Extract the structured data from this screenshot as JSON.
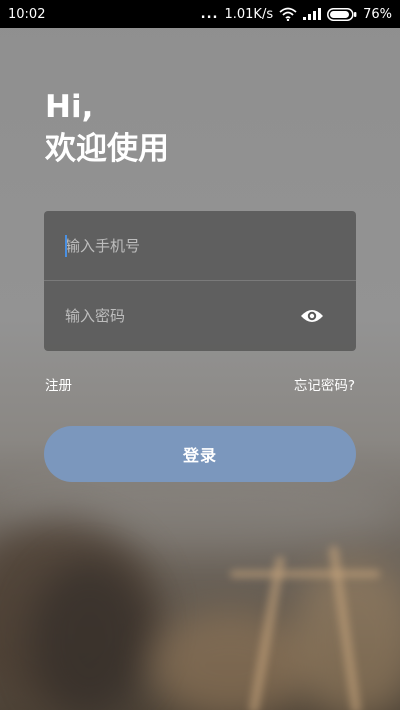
{
  "status_bar": {
    "time": "10:02",
    "signal_dots": "...",
    "network_speed": "1.01K/s",
    "battery_percent": "76%",
    "icons": [
      "wifi-icon",
      "signal-icon",
      "battery-icon"
    ]
  },
  "greeting": {
    "line1": "Hi,",
    "line2": "欢迎使用"
  },
  "form": {
    "phone_placeholder": "输入手机号",
    "phone_value": "",
    "password_placeholder": "输入密码",
    "password_value": "",
    "visibility_icon": "eye-icon"
  },
  "links": {
    "register": "注册",
    "forgot_password": "忘记密码?"
  },
  "login_button": {
    "label": "登录"
  },
  "colors": {
    "accent": "#7b97bd",
    "caret": "#4a90e2",
    "card": "#585858",
    "statusbar": "#000000"
  }
}
